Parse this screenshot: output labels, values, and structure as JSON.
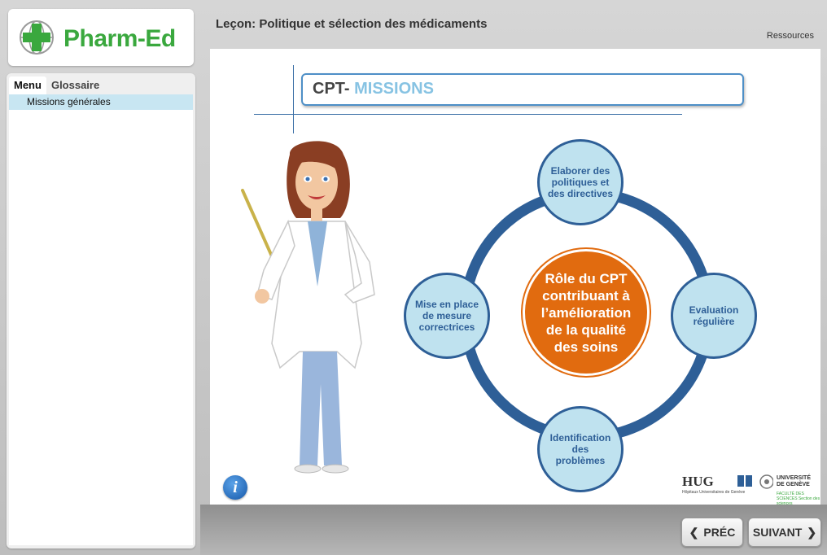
{
  "app": {
    "name": "Pharm-Ed"
  },
  "sidebar": {
    "tabs": [
      {
        "label": "Menu"
      },
      {
        "label": "Glossaire"
      }
    ],
    "items": [
      {
        "label": "Missions générales"
      }
    ]
  },
  "header": {
    "lesson_title": "Leçon: Politique et sélection des médicaments",
    "resources_label": "Ressources"
  },
  "slide": {
    "title_prefix": "CPT-",
    "title_highlight": "MISSIONS",
    "center_text": "Rôle du CPT contribuant à l’amélioration de la qualité des soins",
    "nodes": [
      {
        "text": "Elaborer des politiques et des directives"
      },
      {
        "text": "Evaluation régulière"
      },
      {
        "text": "Identification des problèmes"
      },
      {
        "text": "Mise en place de mesure correctrices"
      }
    ],
    "logos": {
      "hug": "HUG",
      "hug_sub": "Hôpitaux Universitaires de Genève",
      "unige": "UNIVERSITÉ DE GENÈVE",
      "unige_sub": "FACULTÉ DES SCIENCES Section des sciences pharmaceutiques"
    }
  },
  "nav": {
    "prev_label": "PRÉC",
    "next_label": "SUIVANT"
  },
  "colors": {
    "brand_green": "#3aa83e",
    "ring_blue": "#2e5f97",
    "node_fill": "#bfe2ef",
    "center_orange": "#e16b0f",
    "title_blue": "#87c3e3"
  }
}
